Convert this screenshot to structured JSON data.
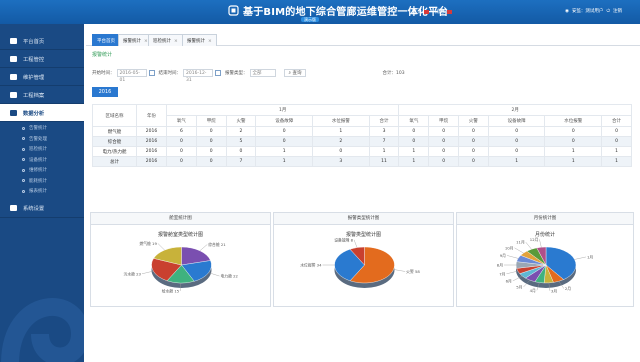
{
  "header": {
    "title": "基于BIM的地下综合管廊运维管控一体化平台",
    "subtitle": "演示版",
    "actions": [
      "首页",
      "消息"
    ],
    "user": [
      "安监：测试用户",
      "注销"
    ]
  },
  "sidebar": {
    "items": [
      {
        "label": "平台首页"
      },
      {
        "label": "工程管控"
      },
      {
        "label": "维护管理"
      },
      {
        "label": "工程档案"
      },
      {
        "label": "数据分析"
      },
      {
        "label": "系统设置"
      }
    ],
    "sub_items": [
      "告警统计",
      "告警处理",
      "巡检统计",
      "设备统计",
      "维修统计",
      "能耗统计",
      "报表统计"
    ]
  },
  "tabs": [
    {
      "label": "平台首页"
    },
    {
      "label": "报警统计"
    },
    {
      "label": "巡检统计"
    },
    {
      "label": "报警统计"
    }
  ],
  "section_title": "报警统计",
  "filters": {
    "date_from_label": "开始时间：",
    "date_from": "2016-05-01",
    "date_to_label": "结束时间：",
    "date_to": "2016-12-31",
    "type_label": "报警类型：",
    "type_value": "全部",
    "query": "查询",
    "total_label": "合计：",
    "total_value": "103"
  },
  "year_button": "2016",
  "table": {
    "col_area": "区域名称",
    "col_year": "年份",
    "group1": "1月",
    "group2": "2月",
    "sub_cols": [
      "氧气",
      "甲烷",
      "火警",
      "设备故障",
      "水位报警",
      "合计"
    ],
    "rows": [
      {
        "area": "燃气舱",
        "year": "2016",
        "m1": [
          "6",
          "0",
          "2",
          "0",
          "1",
          "3"
        ],
        "m2": [
          "0",
          "0",
          "0",
          "0",
          "0",
          "0"
        ]
      },
      {
        "area": "综合舱",
        "year": "2016",
        "m1": [
          "0",
          "0",
          "5",
          "0",
          "2",
          "7"
        ],
        "m2": [
          "0",
          "0",
          "0",
          "0",
          "0",
          "0"
        ]
      },
      {
        "area": "电力/热力舱",
        "year": "2016",
        "m1": [
          "0",
          "0",
          "0",
          "1",
          "0",
          "1"
        ],
        "m2": [
          "1",
          "0",
          "0",
          "0",
          "1",
          "1"
        ]
      },
      {
        "area": "总计",
        "year": "2016",
        "m1": [
          "0",
          "0",
          "7",
          "1",
          "3",
          "11"
        ],
        "m2": [
          "1",
          "0",
          "0",
          "1",
          "1",
          "1"
        ]
      }
    ]
  },
  "panels": [
    {
      "title": "舱室统计图",
      "subtitle": "报警舱室类型统计图"
    },
    {
      "title": "报警类型统计图",
      "subtitle": "报警类型统计图"
    },
    {
      "title": "月份统计图",
      "subtitle": "月份统计"
    }
  ],
  "chart_data": [
    {
      "type": "pie",
      "categories": [
        "燃气舱",
        "综合舱",
        "电力舱",
        "给水舱",
        "污水舱"
      ],
      "values": [
        21,
        22,
        15,
        23,
        19
      ],
      "colors": [
        "#7a4fb0",
        "#2a7ad0",
        "#3fb27f",
        "#c9402f",
        "#c8b23a"
      ],
      "labels": [
        "综合舱 21",
        "电力舱 22",
        "给水舱 15",
        "污水舱 23",
        "燃气舱 19"
      ]
    },
    {
      "type": "pie",
      "categories": [
        "火警",
        "水位报警",
        "设备故障"
      ],
      "values": [
        58,
        34,
        8
      ],
      "colors": [
        "#e36b1e",
        "#2a7ad0",
        "#c9402f"
      ],
      "labels": [
        "火警 58",
        "水位报警 34",
        "设备故障 8"
      ]
    },
    {
      "type": "pie",
      "categories": [
        "1月",
        "2月",
        "3月",
        "4月",
        "5月",
        "6月",
        "7月",
        "8月",
        "9月",
        "10月",
        "11月",
        "12月"
      ],
      "values": [
        40,
        6,
        5,
        5,
        6,
        5,
        5,
        6,
        6,
        5,
        6,
        5
      ],
      "colors": [
        "#2a7ad0",
        "#e36b1e",
        "#c8b23a",
        "#3fb27f",
        "#7a4fb0",
        "#5fb7d4",
        "#c9402f",
        "#9aa7b4",
        "#6a8ad6",
        "#e3a23a",
        "#5a9a3a",
        "#b04f8a"
      ],
      "labels": [
        "1月",
        "2月",
        "3月",
        "4月",
        "5月",
        "6月",
        "7月",
        "8月",
        "9月",
        "10月",
        "11月",
        "12月"
      ]
    }
  ]
}
